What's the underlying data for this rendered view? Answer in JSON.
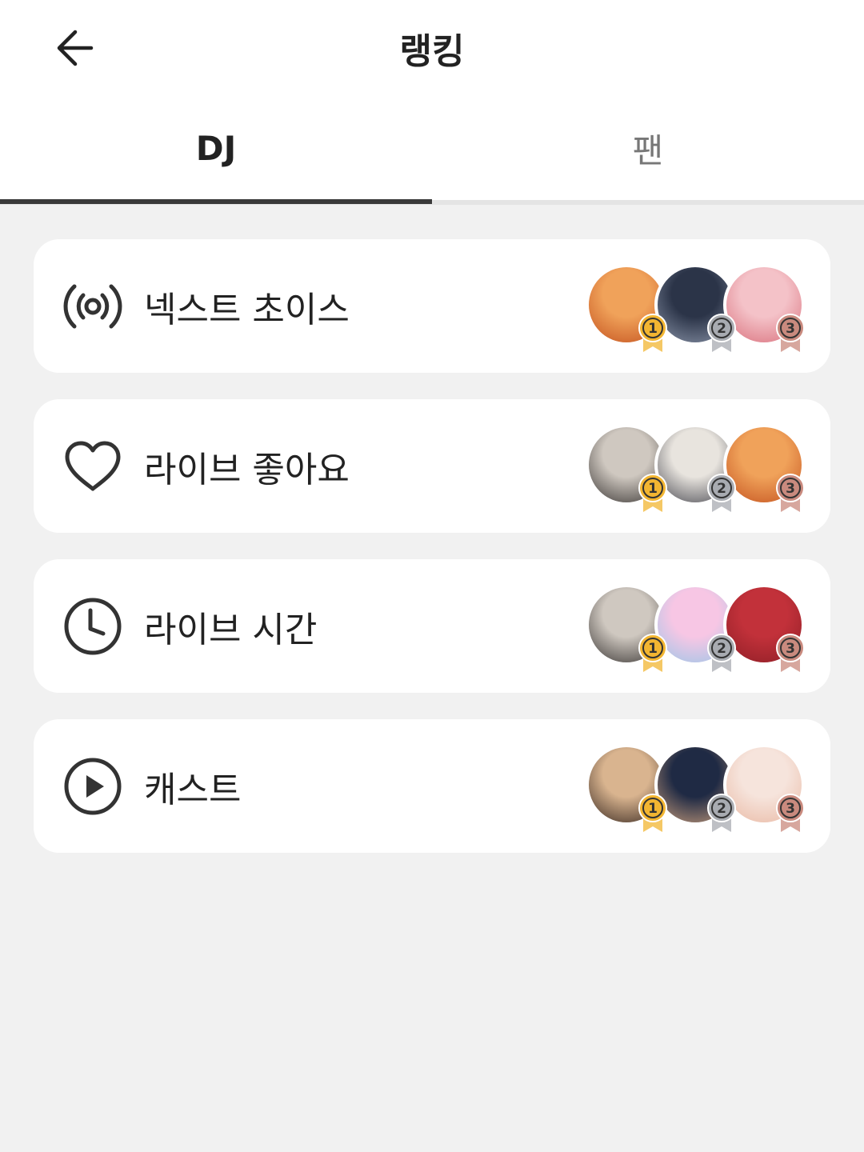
{
  "header": {
    "title": "랭킹",
    "back_icon": "arrow-left-icon"
  },
  "tabs": [
    {
      "label": "DJ",
      "active": true
    },
    {
      "label": "팬",
      "active": false
    }
  ],
  "rankings": [
    {
      "label": "넥스트 초이스",
      "icon": "broadcast-icon",
      "avatars": [
        {
          "rank": "1",
          "colors": [
            "#f0a25a",
            "#c4521f"
          ]
        },
        {
          "rank": "2",
          "colors": [
            "#2b3448",
            "#8a94a8"
          ]
        },
        {
          "rank": "3",
          "colors": [
            "#f4c2c8",
            "#d9707c"
          ]
        }
      ]
    },
    {
      "label": "라이브 좋아요",
      "icon": "heart-icon",
      "avatars": [
        {
          "rank": "1",
          "colors": [
            "#cfc8c0",
            "#3a3634"
          ]
        },
        {
          "rank": "2",
          "colors": [
            "#e8e4de",
            "#4a4a52"
          ]
        },
        {
          "rank": "3",
          "colors": [
            "#f0a25a",
            "#c4521f"
          ]
        }
      ]
    },
    {
      "label": "라이브 시간",
      "icon": "clock-icon",
      "avatars": [
        {
          "rank": "1",
          "colors": [
            "#cfc8c0",
            "#3a3634"
          ]
        },
        {
          "rank": "2",
          "colors": [
            "#f7c6e4",
            "#9cc6e8"
          ]
        },
        {
          "rank": "3",
          "colors": [
            "#c2313a",
            "#8e1e26"
          ]
        }
      ]
    },
    {
      "label": "캐스트",
      "icon": "play-circle-icon",
      "avatars": [
        {
          "rank": "1",
          "colors": [
            "#d9b48f",
            "#3a2a22"
          ]
        },
        {
          "rank": "2",
          "colors": [
            "#1f2a44",
            "#c49a7a"
          ]
        },
        {
          "rank": "3",
          "colors": [
            "#f6e4dc",
            "#e9b9a4"
          ]
        }
      ]
    }
  ],
  "medal_colors": {
    "1": "#f2b531",
    "2": "#a8abb1",
    "3": "#c98a7e"
  }
}
